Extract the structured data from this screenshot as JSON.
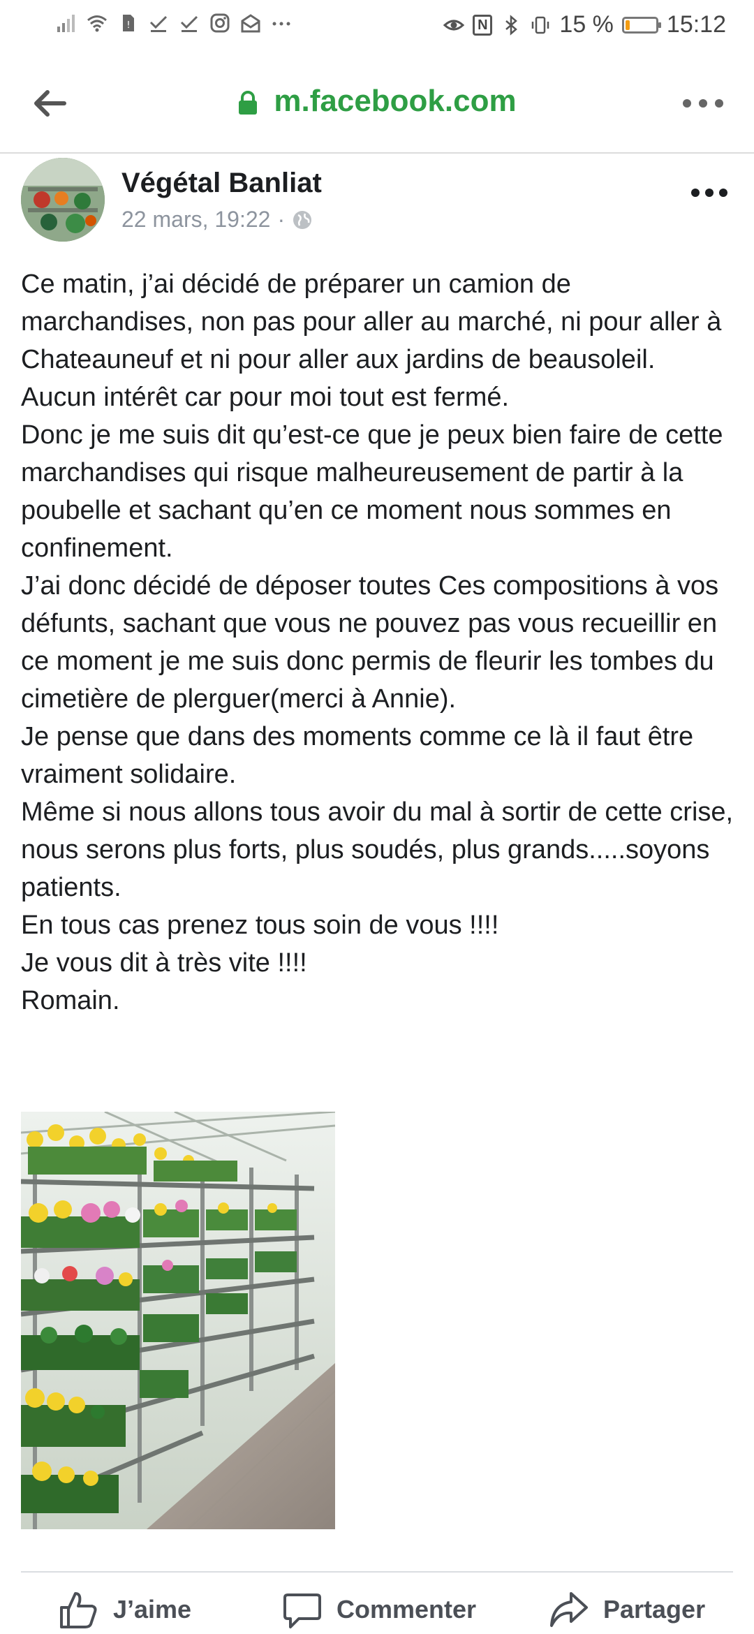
{
  "status_bar": {
    "battery_text": "15 %",
    "battery_level": 0.15,
    "time": "15:12",
    "nfc_label": "N"
  },
  "browser": {
    "url": "m.facebook.com",
    "url_color": "#2e9e44"
  },
  "post": {
    "author": "Végétal Banliat",
    "date": "22 mars, 19:22",
    "separator": "·",
    "paragraphs": [
      "Ce matin, j’ai décidé de préparer un camion de marchandises, non pas pour aller au marché, ni pour aller à Chateauneuf et ni pour aller aux jardins de beausoleil.",
      "Aucun intérêt car pour moi tout est fermé.",
      "Donc je me suis dit qu’est-ce que je peux bien faire de cette marchandises qui risque malheureusement de partir à la poubelle et sachant qu’en ce moment nous sommes en confinement.",
      "J’ai donc décidé de déposer toutes Ces compositions à vos défunts, sachant que vous ne pouvez pas vous recueillir en ce moment je me suis donc permis de fleurir les tombes du cimetière de plerguer(merci à Annie).",
      "Je pense que dans des moments comme ce là il faut être vraiment solidaire.",
      "Même si nous allons tous avoir du mal à sortir de cette crise, nous serons plus forts, plus soudés, plus grands.....soyons patients.",
      "En tous cas prenez tous soin de vous !!!!",
      "Je vous dit à très vite !!!!",
      "Romain."
    ]
  },
  "actions": {
    "like": "J’aime",
    "comment": "Commenter",
    "share": "Partager"
  },
  "icons": [
    "signal-icon",
    "wifi-icon",
    "sim-icon",
    "check-icon",
    "instagram-icon",
    "mail-icon",
    "eye-icon",
    "bluetooth-icon",
    "vibrate-icon",
    "battery-icon",
    "back-arrow-icon",
    "lock-icon",
    "more-icon",
    "globe-icon",
    "like-icon",
    "comment-icon",
    "share-icon"
  ]
}
